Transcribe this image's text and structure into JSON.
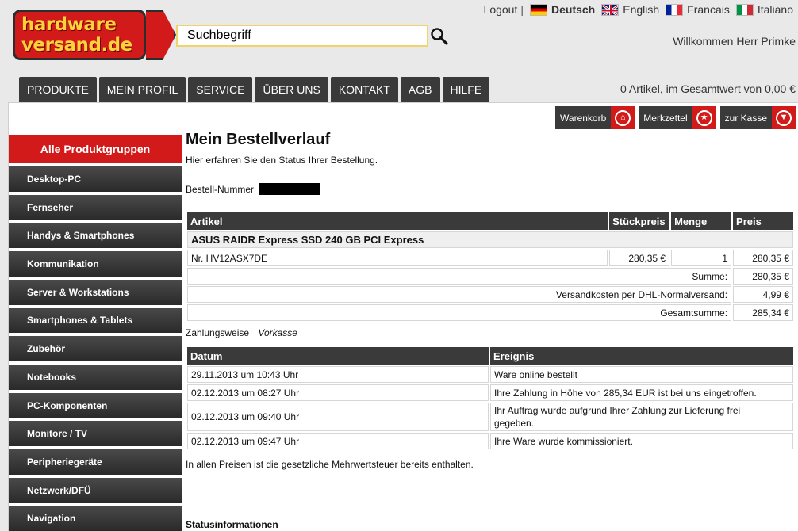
{
  "brand": {
    "logo_text_1": "hardware",
    "logo_text_2": "versand.de"
  },
  "search": {
    "value": "Suchbegriff"
  },
  "topbar": {
    "logout": "Logout",
    "separator": "|",
    "languages": [
      {
        "label": "Deutsch",
        "active": true,
        "icon": "flag-de-icon"
      },
      {
        "label": "English",
        "active": false,
        "icon": "flag-uk-icon"
      },
      {
        "label": "Francais",
        "active": false,
        "icon": "flag-fr-icon"
      },
      {
        "label": "Italiano",
        "active": false,
        "icon": "flag-it-icon"
      }
    ],
    "welcome": "Willkommen Herr Primke"
  },
  "nav": [
    "PRODUKTE",
    "MEIN PROFIL",
    "SERVICE",
    "ÜBER UNS",
    "KONTAKT",
    "AGB",
    "HILFE"
  ],
  "cart_summary": "0 Artikel, im Gesamtwert von 0,00 €",
  "actions": [
    {
      "label": "Warenkorb",
      "icon": "basket-icon"
    },
    {
      "label": "Merkzettel",
      "icon": "star-icon"
    },
    {
      "label": "zur Kasse",
      "icon": "checkout-icon"
    }
  ],
  "sidebar": {
    "head": "Alle Produktgruppen",
    "categories": [
      "Desktop-PC",
      "Fernseher",
      "Handys & Smartphones",
      "Kommunikation",
      "Server & Workstations",
      "Smartphones & Tablets",
      "Zubehör",
      "Notebooks",
      "PC-Komponenten",
      "Monitore / TV",
      "Peripheriegeräte",
      "Netzwerk/DFÜ",
      "Navigation"
    ]
  },
  "main": {
    "title": "Mein Bestellverlauf",
    "intro": "Hier erfahren Sie den Status Ihrer Bestellung.",
    "order_number_label": "Bestell-Nummer",
    "items_table": {
      "headers": [
        "Artikel",
        "Stückpreis",
        "Menge",
        "Preis"
      ],
      "product_name": "ASUS RAIDR Express SSD 240 GB PCI Express",
      "product_number": "Nr. HV12ASX7DE",
      "unit_price": "280,35 €",
      "quantity": "1",
      "price": "280,35 €",
      "summe_label": "Summe:",
      "summe": "280,35 €",
      "shipping_label": "Versandkosten per DHL-Normalversand:",
      "shipping": "4,99 €",
      "total_label": "Gesamtsumme:",
      "total": "285,34 €"
    },
    "payment_label": "Zahlungsweise",
    "payment_value": "Vorkasse",
    "events_table": {
      "headers": [
        "Datum",
        "Ereignis"
      ],
      "rows": [
        {
          "date": "29.11.2013 um 10:43 Uhr",
          "event": "Ware online bestellt"
        },
        {
          "date": "02.12.2013 um 08:27 Uhr",
          "event": "Ihre Zahlung in Höhe von 285,34 EUR ist bei uns eingetroffen."
        },
        {
          "date": "02.12.2013 um 09:40 Uhr",
          "event": "Ihr Auftrag wurde aufgrund Ihrer Zahlung zur Lieferung frei gegeben."
        },
        {
          "date": "02.12.2013 um 09:47 Uhr",
          "event": "Ihre Ware wurde kommissioniert."
        }
      ]
    },
    "vat_note": "In allen Preisen ist die gesetzliche Mehrwertsteuer bereits enthalten.",
    "status_title": "Statusinformationen"
  },
  "colors": {
    "brand_red": "#d31a1a",
    "brand_yellow": "#ffd23c",
    "dark": "#3a3a3a"
  }
}
